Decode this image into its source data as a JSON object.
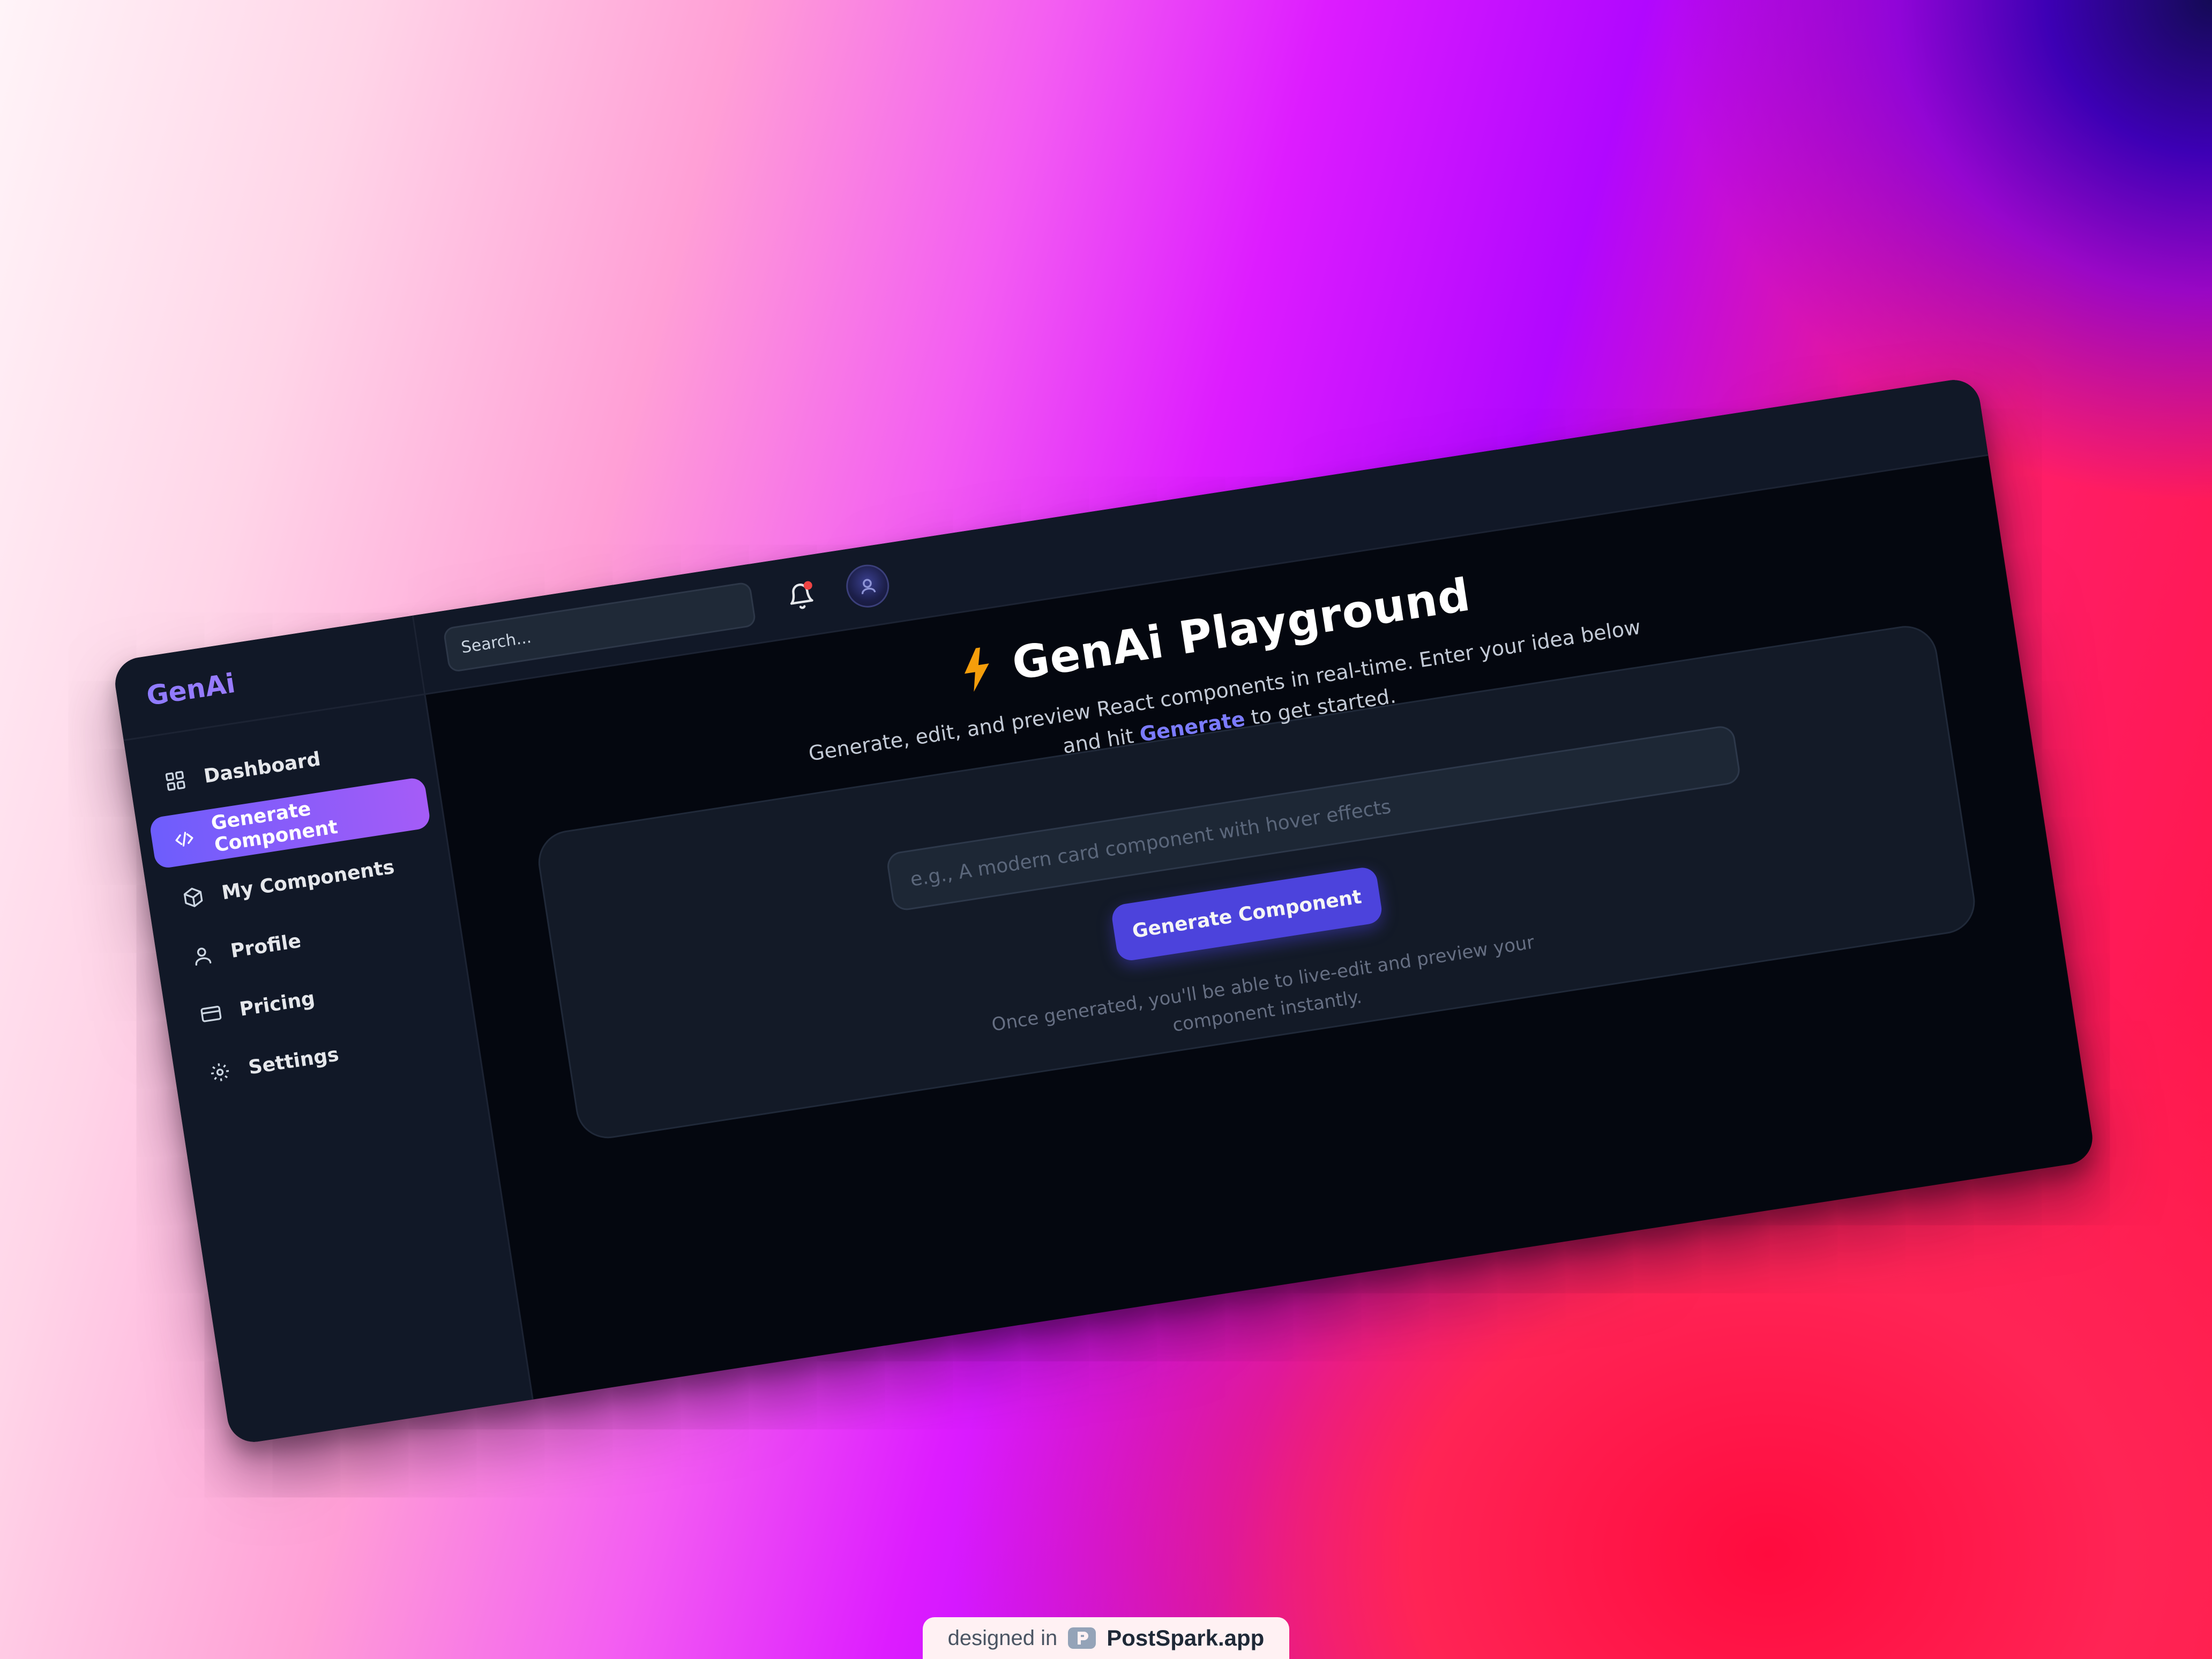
{
  "app": {
    "brand": "GenAi"
  },
  "sidebar": {
    "items": [
      {
        "label": "Dashboard",
        "icon": "grid-icon",
        "active": false
      },
      {
        "label": "Generate Component",
        "icon": "code-icon",
        "active": true
      },
      {
        "label": "My Components",
        "icon": "cube-icon",
        "active": false
      },
      {
        "label": "Profile",
        "icon": "user-icon",
        "active": false
      },
      {
        "label": "Pricing",
        "icon": "credit-card-icon",
        "active": false
      },
      {
        "label": "Settings",
        "icon": "gear-icon",
        "active": false
      }
    ]
  },
  "topbar": {
    "search_placeholder": "Search...",
    "notification_icon": "bell-icon",
    "avatar_icon": "avatar"
  },
  "main": {
    "title": "GenAi Playground",
    "title_icon": "lightning-bolt-icon",
    "subtitle_before": "Generate, edit, and preview React components in real-time. Enter your idea below and hit ",
    "subtitle_link": "Generate",
    "subtitle_after": " to get started.",
    "prompt_placeholder": "e.g., A modern card component with hover effects",
    "generate_button": "Generate Component",
    "hint": "Once generated, you'll be able to live-edit and preview your component instantly."
  },
  "footer": {
    "prefix": "designed in",
    "brand": "PostSpark.app"
  },
  "colors": {
    "accent": "#4f46e5",
    "active_nav_start": "#6d5dfc",
    "active_nav_end": "#a55cf7",
    "sidebar_bg": "#111827",
    "main_bg": "#04070f",
    "bolt": "#f59e0b",
    "notification_dot": "#ef4444"
  }
}
